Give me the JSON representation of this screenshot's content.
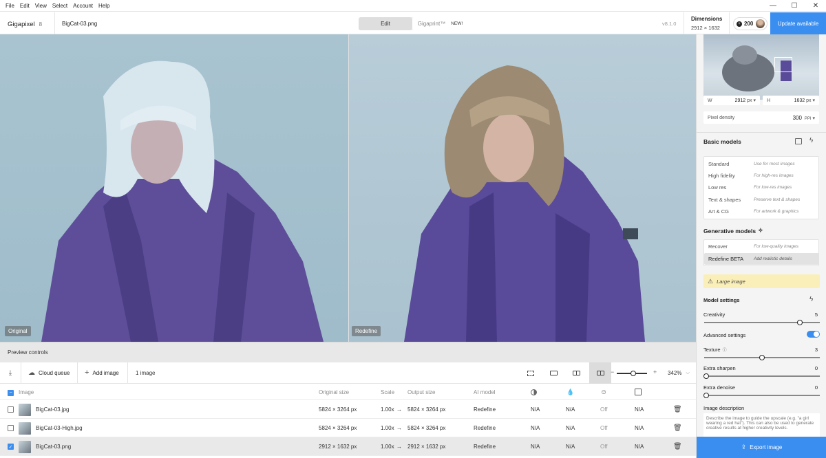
{
  "menu": {
    "items": [
      "File",
      "Edit",
      "View",
      "Select",
      "Account",
      "Help"
    ]
  },
  "window_controls": {
    "minimize": "—",
    "maximize": "☐",
    "close": "✕"
  },
  "app": {
    "name": "Gigapixel",
    "version_badge": "8",
    "version": "v8.1.0"
  },
  "file": {
    "name": "BigCat-03.png"
  },
  "mode_tabs": {
    "edit": "Edit",
    "gigaprint": "Gigaprint™",
    "new_badge": "NEW!"
  },
  "dimensions": {
    "label": "Dimensions",
    "value": "2912 × 1632"
  },
  "credits": {
    "count": "200"
  },
  "update_button": "Update available",
  "canvas": {
    "left_tag": "Original",
    "right_tag": "Redefine"
  },
  "preview_controls": "Preview controls",
  "toolbar": {
    "cloud_queue": "Cloud queue",
    "add_image": "Add image",
    "image_count": "1 image",
    "zoom": "342%",
    "zoom_minus": "−",
    "zoom_plus": "+",
    "zoom_level": 0.55
  },
  "table": {
    "headers": {
      "image": "Image",
      "original_size": "Original size",
      "scale": "Scale",
      "output_size": "Output size",
      "ai_model": "AI model"
    },
    "rows": [
      {
        "name": "BigCat-03.jpg",
        "original": "5824 × 3264 px",
        "scale": "1.00x",
        "arrow": "→",
        "output": "5824 × 3264 px",
        "model": "Redefine",
        "c1": "N/A",
        "c2": "N/A",
        "c3": "Off",
        "c4": "N/A",
        "checked": false
      },
      {
        "name": "BigCat-03-High.jpg",
        "original": "5824 × 3264 px",
        "scale": "1.00x",
        "arrow": "→",
        "output": "5824 × 3264 px",
        "model": "Redefine",
        "c1": "N/A",
        "c2": "N/A",
        "c3": "Off",
        "c4": "N/A",
        "checked": false
      },
      {
        "name": "BigCat-03.png",
        "original": "2912 × 1632 px",
        "scale": "1.00x",
        "arrow": "→",
        "output": "2912 × 1632 px",
        "model": "Redefine",
        "c1": "N/A",
        "c2": "N/A",
        "c3": "Off",
        "c4": "N/A",
        "checked": true
      }
    ]
  },
  "sidebar": {
    "width_label": "W",
    "width_value": "2912",
    "width_unit": "px",
    "height_label": "H",
    "height_value": "1632",
    "height_unit": "px",
    "density_label": "Pixel density",
    "density_value": "300",
    "density_unit": "PPI",
    "basic_models_title": "Basic models",
    "basic_models": [
      {
        "name": "Standard",
        "desc": "Use for most images"
      },
      {
        "name": "High fidelity",
        "desc": "For high-res images"
      },
      {
        "name": "Low res",
        "desc": "For low-res images"
      },
      {
        "name": "Text & shapes",
        "desc": "Preserve text & shapes"
      },
      {
        "name": "Art & CG",
        "desc": "For artwork & graphics"
      }
    ],
    "gen_models_title": "Generative models",
    "gen_models": [
      {
        "name": "Recover",
        "desc": "For low-quality images"
      },
      {
        "name": "Redefine BETA",
        "desc": "Add realistic details"
      }
    ],
    "warning": "Large image",
    "model_settings_title": "Model settings",
    "creativity_label": "Creativity",
    "creativity_value": "5",
    "creativity_level": 0.83,
    "advanced_label": "Advanced settings",
    "texture_label": "Texture",
    "texture_value": "3",
    "texture_level": 0.5,
    "sharpen_label": "Extra sharpen",
    "sharpen_value": "0",
    "denoise_label": "Extra denoise",
    "denoise_value": "0",
    "desc_label": "Image description",
    "desc_placeholder": "Describe the image to guide the upscale (e.g. \"a girl wearing a red hat\"). This can also be used to generate creative results at higher creativity levels.",
    "export_button": "Export image"
  },
  "colors": {
    "accent": "#3a8ef0",
    "warning_bg": "#faefb8",
    "canvas_bg": "#a7c2cf",
    "jacket": "#5a4a9a"
  }
}
